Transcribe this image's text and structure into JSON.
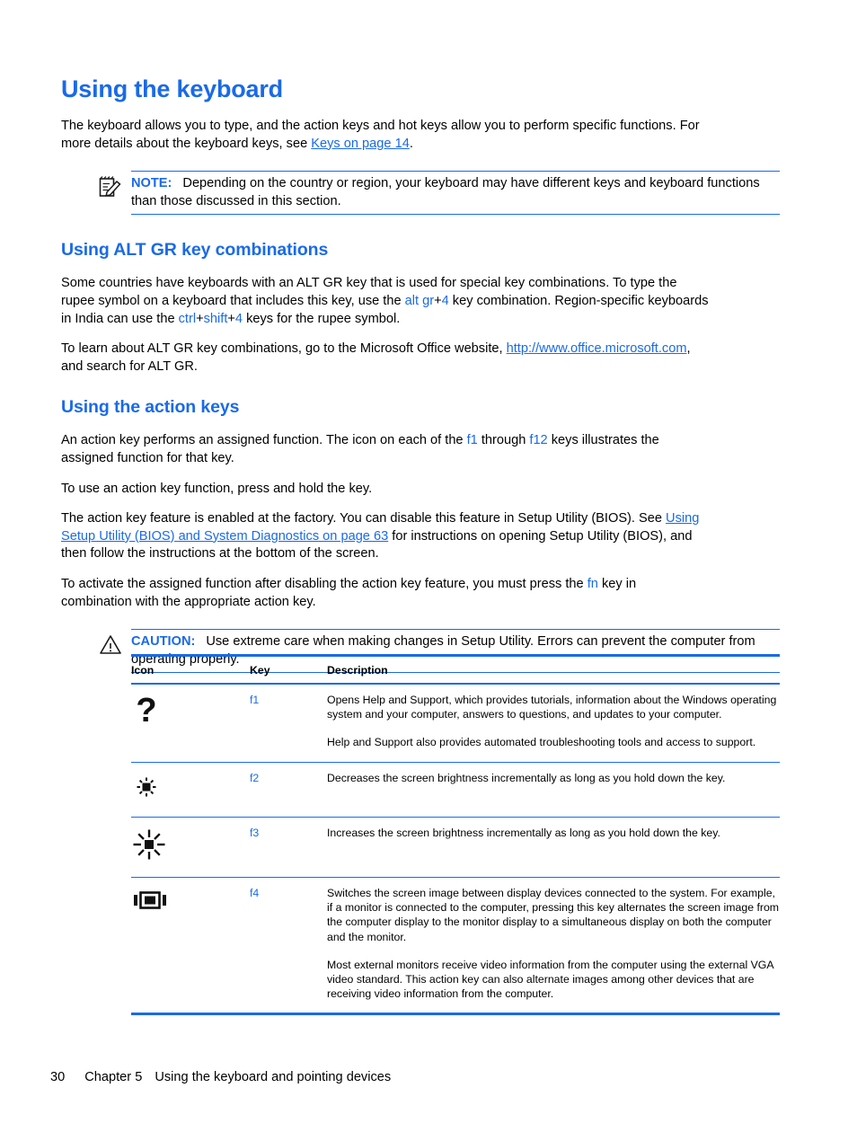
{
  "page": {
    "title": "Using the keyboard"
  },
  "intro": {
    "text_before_link": "The keyboard allows you to type, and the action keys and hot keys allow you to perform specific functions. For more details about the keyboard keys, see ",
    "link": "Keys on page 14",
    "text_after_link": "."
  },
  "note": {
    "icon": "note-pad-pencil-icon",
    "label": "NOTE:",
    "text": "Depending on the country or region, your keyboard may have different keys and keyboard functions than those discussed in this section."
  },
  "altgr": {
    "heading": "Using ALT GR key combinations",
    "p1_a": "Some countries have keyboards with an ALT GR key that is used for special key combinations. To type the rupee symbol on a keyboard that includes this key, use the ",
    "p1_key1": "alt gr",
    "p1_plus1": "+",
    "p1_key2": "4",
    "p1_b": " key combination. Region-specific keyboards in India can use the ",
    "p1_key3": "ctrl",
    "p1_plus2": "+",
    "p1_key4": "shift",
    "p1_plus3": "+",
    "p1_key5": "4",
    "p1_c": " keys for the rupee symbol.",
    "p2_a": "To learn about ALT GR key combinations, go to the Microsoft Office website, ",
    "p2_link": "http://www.office.microsoft.com",
    "p2_b": ", and search for ALT GR."
  },
  "actionkeys": {
    "heading": "Using the action keys",
    "p1_a": "An action key performs an assigned function. The icon on each of the ",
    "p1_k1": "f1",
    "p1_b": " through ",
    "p1_k2": "f12",
    "p1_c": " keys illustrates the assigned function for that key.",
    "p2": "To use an action key function, press and hold the key.",
    "p3_a": "The action key feature is enabled at the factory. You can disable this feature in Setup Utility (BIOS). See ",
    "p3_link": "Using Setup Utility (BIOS) and System Diagnostics on page 63",
    "p3_b": " for instructions on opening Setup Utility (BIOS), and then follow the instructions at the bottom of the screen.",
    "p4_a": "To activate the assigned function after disabling the action key feature, you must press the ",
    "p4_k1": "fn",
    "p4_b": " key in combination with the appropriate action key."
  },
  "caution": {
    "icon": "warning-triangle-icon",
    "label": "CAUTION:",
    "text": "Use extreme care when making changes in Setup Utility. Errors can prevent the computer from operating properly."
  },
  "table": {
    "headers": [
      "Icon",
      "Key",
      "Description"
    ],
    "rows": [
      {
        "icon": "question-mark-icon",
        "key": "f1",
        "paragraphs": [
          "Opens Help and Support, which provides tutorials, information about the Windows operating system and your computer, answers to questions, and updates to your computer.",
          "Help and Support also provides automated troubleshooting tools and access to support."
        ]
      },
      {
        "icon": "brightness-decrease-sun-icon",
        "key": "f2",
        "paragraphs": [
          "Decreases the screen brightness incrementally as long as you hold down the key."
        ]
      },
      {
        "icon": "brightness-increase-sun-icon",
        "key": "f3",
        "paragraphs": [
          "Increases the screen brightness incrementally as long as you hold down the key."
        ]
      },
      {
        "icon": "switch-screen-image-monitor-icon",
        "key": "f4",
        "paragraphs": [
          "Switches the screen image between display devices connected to the system. For example, if a monitor is connected to the computer, pressing this key alternates the screen image from the computer display to the monitor display to a simultaneous display on both the computer and the monitor.",
          "Most external monitors receive video information from the computer using the external VGA video standard. This action key can also alternate images among other devices that are receiving video information from the computer."
        ]
      }
    ]
  },
  "footer": {
    "page_number": "30",
    "chapter": "Chapter 5",
    "chapter_title": "Using the keyboard and pointing devices"
  },
  "colors": {
    "accent_blue": "#1a6ae8",
    "text_black": "#000000"
  }
}
